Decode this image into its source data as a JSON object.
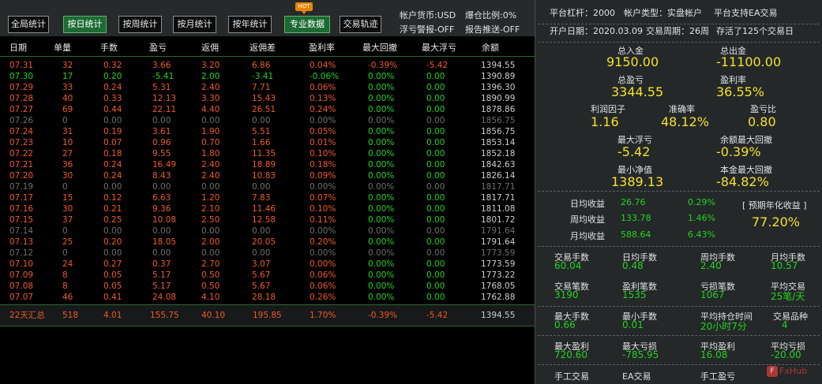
{
  "toolbar": {
    "hot_badge": "HOT",
    "buttons": [
      "全局统计",
      "按日统计",
      "按周统计",
      "按月统计",
      "按年统计",
      "专业数据",
      "交易轨迹"
    ]
  },
  "account_info": {
    "currency": "帐户货币:USD",
    "margin_ratio": "爆仓比例:0%",
    "float_alert": "浮亏警报-OFF",
    "report_push": "报告推送-OFF"
  },
  "columns": [
    "日期",
    "单量",
    "手数",
    "盈亏",
    "返佣",
    "返佣差",
    "盈利率",
    "最大回撤",
    "最大浮亏",
    "余额"
  ],
  "rows": [
    {
      "date": "07.31",
      "orders": "32",
      "lots": "0.32",
      "pl": "3.66",
      "rebate": "3.20",
      "rebate_diff": "6.86",
      "rate": "0.04%",
      "max_dd": "-0.39%",
      "max_float": "-5.42",
      "balance": "1394.55",
      "color": "red"
    },
    {
      "date": "07.30",
      "orders": "17",
      "lots": "0.20",
      "pl": "-5.41",
      "rebate": "2.00",
      "rebate_diff": "-3.41",
      "rate": "-0.06%",
      "max_dd": "0.00%",
      "max_float": "0.00",
      "balance": "1390.89",
      "color": "green"
    },
    {
      "date": "07.29",
      "orders": "33",
      "lots": "0.24",
      "pl": "5.31",
      "rebate": "2.40",
      "rebate_diff": "7.71",
      "rate": "0.06%",
      "max_dd": "0.00%",
      "max_float": "0.00",
      "balance": "1396.30",
      "color": "red"
    },
    {
      "date": "07.28",
      "orders": "40",
      "lots": "0.33",
      "pl": "12.13",
      "rebate": "3.30",
      "rebate_diff": "15.43",
      "rate": "0.13%",
      "max_dd": "0.00%",
      "max_float": "0.00",
      "balance": "1890.99",
      "color": "red"
    },
    {
      "date": "07.27",
      "orders": "69",
      "lots": "0.44",
      "pl": "22.11",
      "rebate": "4.40",
      "rebate_diff": "26.51",
      "rate": "0.24%",
      "max_dd": "0.00%",
      "max_float": "0.00",
      "balance": "1878.86",
      "color": "red"
    },
    {
      "date": "07.26",
      "orders": "0",
      "lots": "0.00",
      "pl": "0.00",
      "rebate": "0.00",
      "rebate_diff": "0.00",
      "rate": "0.00%",
      "max_dd": "0.00%",
      "max_float": "0.00",
      "balance": "1856.75",
      "color": "grey"
    },
    {
      "date": "07.24",
      "orders": "31",
      "lots": "0.19",
      "pl": "3.61",
      "rebate": "1.90",
      "rebate_diff": "5.51",
      "rate": "0.05%",
      "max_dd": "0.00%",
      "max_float": "0.00",
      "balance": "1856.75",
      "color": "red"
    },
    {
      "date": "07.23",
      "orders": "10",
      "lots": "0.07",
      "pl": "0.96",
      "rebate": "0.70",
      "rebate_diff": "1.66",
      "rate": "0.01%",
      "max_dd": "0.00%",
      "max_float": "0.00",
      "balance": "1853.14",
      "color": "red"
    },
    {
      "date": "07.22",
      "orders": "27",
      "lots": "0.18",
      "pl": "9.55",
      "rebate": "1.80",
      "rebate_diff": "11.35",
      "rate": "0.10%",
      "max_dd": "0.00%",
      "max_float": "0.00",
      "balance": "1852.18",
      "color": "red"
    },
    {
      "date": "07.21",
      "orders": "36",
      "lots": "0.24",
      "pl": "16.49",
      "rebate": "2.40",
      "rebate_diff": "18.89",
      "rate": "0.18%",
      "max_dd": "0.00%",
      "max_float": "0.00",
      "balance": "1842.63",
      "color": "red"
    },
    {
      "date": "07.20",
      "orders": "30",
      "lots": "0.24",
      "pl": "8.43",
      "rebate": "2.40",
      "rebate_diff": "10.83",
      "rate": "0.09%",
      "max_dd": "0.00%",
      "max_float": "0.00",
      "balance": "1826.14",
      "color": "red"
    },
    {
      "date": "07.19",
      "orders": "0",
      "lots": "0.00",
      "pl": "0.00",
      "rebate": "0.00",
      "rebate_diff": "0.00",
      "rate": "0.00%",
      "max_dd": "0.00%",
      "max_float": "0.00",
      "balance": "1817.71",
      "color": "grey"
    },
    {
      "date": "07.17",
      "orders": "15",
      "lots": "0.12",
      "pl": "6.63",
      "rebate": "1.20",
      "rebate_diff": "7.83",
      "rate": "0.07%",
      "max_dd": "0.00%",
      "max_float": "0.00",
      "balance": "1817.71",
      "color": "red"
    },
    {
      "date": "07.16",
      "orders": "30",
      "lots": "0.21",
      "pl": "9.36",
      "rebate": "2.10",
      "rebate_diff": "11.46",
      "rate": "0.10%",
      "max_dd": "0.00%",
      "max_float": "0.00",
      "balance": "1811.08",
      "color": "red"
    },
    {
      "date": "07.15",
      "orders": "37",
      "lots": "0.25",
      "pl": "10.08",
      "rebate": "2.50",
      "rebate_diff": "12.58",
      "rate": "0.11%",
      "max_dd": "0.00%",
      "max_float": "0.00",
      "balance": "1801.72",
      "color": "red"
    },
    {
      "date": "07.14",
      "orders": "0",
      "lots": "0.00",
      "pl": "0.00",
      "rebate": "0.00",
      "rebate_diff": "0.00",
      "rate": "0.00%",
      "max_dd": "0.00%",
      "max_float": "0.00",
      "balance": "1791.64",
      "color": "grey"
    },
    {
      "date": "07.13",
      "orders": "25",
      "lots": "0.20",
      "pl": "18.05",
      "rebate": "2.00",
      "rebate_diff": "20.05",
      "rate": "0.20%",
      "max_dd": "0.00%",
      "max_float": "0.00",
      "balance": "1791.64",
      "color": "red"
    },
    {
      "date": "07.12",
      "orders": "0",
      "lots": "0.00",
      "pl": "0.00",
      "rebate": "0.00",
      "rebate_diff": "0.00",
      "rate": "0.00%",
      "max_dd": "0.00%",
      "max_float": "0.00",
      "balance": "1773.59",
      "color": "grey"
    },
    {
      "date": "07.10",
      "orders": "24",
      "lots": "0.27",
      "pl": "0.37",
      "rebate": "2.70",
      "rebate_diff": "3.07",
      "rate": "0.00%",
      "max_dd": "0.00%",
      "max_float": "0.00",
      "balance": "1773.59",
      "color": "red"
    },
    {
      "date": "07.09",
      "orders": "8",
      "lots": "0.05",
      "pl": "5.17",
      "rebate": "0.50",
      "rebate_diff": "5.67",
      "rate": "0.06%",
      "max_dd": "0.00%",
      "max_float": "0.00",
      "balance": "1773.22",
      "color": "red"
    },
    {
      "date": "07.08",
      "orders": "8",
      "lots": "0.05",
      "pl": "5.17",
      "rebate": "0.50",
      "rebate_diff": "5.67",
      "rate": "0.06%",
      "max_dd": "0.00%",
      "max_float": "0.00",
      "balance": "1768.05",
      "color": "red"
    },
    {
      "date": "07.07",
      "orders": "46",
      "lots": "0.41",
      "pl": "24.08",
      "rebate": "4.10",
      "rebate_diff": "28.18",
      "rate": "0.26%",
      "max_dd": "0.00%",
      "max_float": "0.00",
      "balance": "1762.88",
      "color": "red"
    }
  ],
  "summary": {
    "label": "22天汇总",
    "orders": "518",
    "lots": "4.01",
    "pl": "155.75",
    "rebate": "40.10",
    "rebate_diff": "195.85",
    "rate": "1.70%",
    "max_dd": "-0.39%",
    "max_float": "-5.42",
    "balance": "1394.55"
  },
  "right": {
    "leverage": "平台杠杆：2000",
    "account_type": "帐户类型：实盘帐户",
    "ea_support": "平台支持EA交易",
    "open_date": "开户日期：2020.03.09",
    "trade_cycle": "交易周期：26周",
    "survived": "存活了125个交易日",
    "deposit_label": "总入金",
    "deposit_value": "9150.00",
    "withdraw_label": "总出金",
    "withdraw_value": "-11100.00",
    "pl_label": "总盈亏",
    "pl_value": "3344.55",
    "profit_rate_label": "盈利率",
    "profit_rate_value": "36.55%",
    "profit_factor_label": "利润因子",
    "profit_factor_value": "1.16",
    "accuracy_label": "准确率",
    "accuracy_value": "48.12%",
    "pl_ratio_label": "盈亏比",
    "pl_ratio_value": "0.80",
    "max_float_label": "最大浮亏",
    "max_float_value": "-5.42",
    "bal_max_dd_label": "余额最大回撤",
    "bal_max_dd_value": "-0.39%",
    "min_equity_label": "最小净值",
    "min_equity_value": "1389.13",
    "principal_dd_label": "本金最大回撤",
    "principal_dd_value": "-84.82%",
    "daily_label": "日均收益",
    "daily_value": "26.76",
    "daily_pct": "0.29%",
    "weekly_label": "周均收益",
    "weekly_value": "133.78",
    "weekly_pct": "1.46%",
    "monthly_label": "月均收益",
    "monthly_value": "588.64",
    "monthly_pct": "6.43%",
    "annual_label": "[ 预期年化收益 ]",
    "annual_value": "77.20%",
    "trade_lots_label": "交易手数",
    "trade_lots_value": "60.04",
    "day_lots_label": "日均手数",
    "day_lots_value": "0.48",
    "week_lots_label": "周均手数",
    "week_lots_value": "2.40",
    "month_lots_label": "月均手数",
    "month_lots_value": "10.57",
    "trades_label": "交易笔数",
    "trades_value": "3190",
    "win_trades_label": "盈利笔数",
    "win_trades_value": "1535",
    "loss_trades_label": "亏损笔数",
    "loss_trades_value": "1067",
    "avg_trade_label": "平均交易",
    "avg_trade_value": "25笔/天",
    "max_lots_label": "最大手数",
    "max_lots_value": "0.66",
    "min_lots_label": "最小手数",
    "min_lots_value": "0.01",
    "avg_hold_label": "平均持仓时间",
    "avg_hold_value": "20小时7分",
    "symbols_label": "交易品种",
    "symbols_value": "4",
    "max_win_label": "最大盈利",
    "max_win_value": "720.60",
    "max_loss_label": "最大亏损",
    "max_loss_value": "-785.95",
    "avg_win_label": "平均盈利",
    "avg_win_value": "16.08",
    "avg_loss_label": "平均亏损",
    "avg_loss_value": "-20.00",
    "manual_label": "手工交易",
    "ea_label": "EA交易",
    "manual_pl_label": "手工盈亏",
    "watermark": "FxHub"
  }
}
